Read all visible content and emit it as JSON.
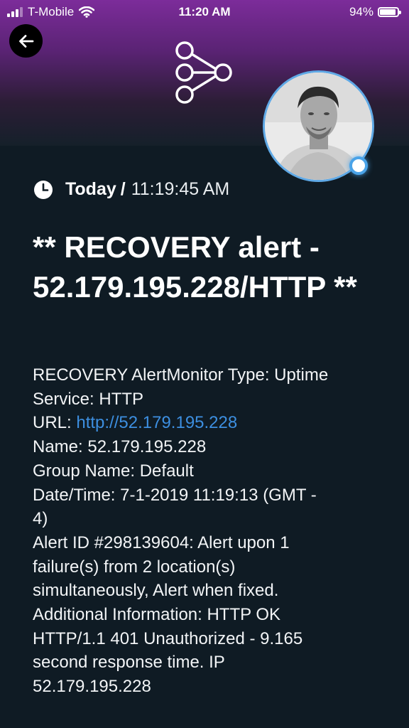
{
  "status_bar": {
    "carrier": "T-Mobile",
    "time": "11:20 AM",
    "battery": "94%",
    "battery_level": 0.94,
    "signal_bars": 3
  },
  "header": {
    "back_icon": "arrow-left-icon",
    "share_icon": "share-nodes-icon"
  },
  "timestamp": {
    "day": "Today",
    "separator": "/",
    "time": "11:19:45 AM"
  },
  "alert": {
    "title": "** RECOVERY alert - 52.179.195.228/HTTP **",
    "lines": [
      {
        "text": "RECOVERY AlertMonitor Type: Uptime"
      },
      {
        "text": "Service: HTTP"
      },
      {
        "label": "URL: ",
        "link": "http://52.179.195.228"
      },
      {
        "text": "Name: 52.179.195.228"
      },
      {
        "text": "Group Name: Default"
      },
      {
        "text": "Date/Time: 7-1-2019 11:19:13 (GMT -"
      },
      {
        "text": "4)"
      },
      {
        "text": "Alert ID #298139604: Alert upon 1"
      },
      {
        "text": "failure(s) from 2 location(s)"
      },
      {
        "text": "simultaneously, Alert when fixed."
      },
      {
        "text": "Additional Information:   HTTP OK"
      },
      {
        "text": "HTTP/1.1 401 Unauthorized - 9.165"
      },
      {
        "text": "second response time. IP"
      },
      {
        "text": "52.179.195.228"
      }
    ]
  },
  "colors": {
    "header_top": "#7c2c9a",
    "background": "#0f1b24",
    "link": "#3d8fe0",
    "status_ring": "#4aa3e8"
  }
}
